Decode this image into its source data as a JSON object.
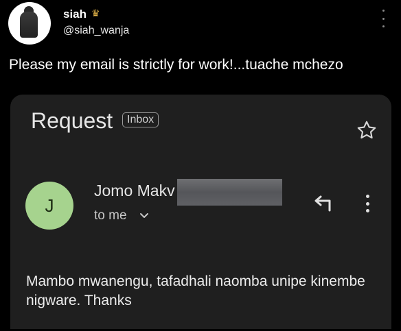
{
  "post": {
    "author_name": "siah",
    "author_badge": "crown-emoji-icon",
    "author_handle": "@siah_wanja",
    "text": "Please my email is strictly for work!...tuache mchezo",
    "more_icon": "vertical-dots-icon"
  },
  "email": {
    "subject": "Request",
    "label": "Inbox",
    "star_icon": "star-outline-icon",
    "sender_initial": "J",
    "sender_name": "Jomo Makv",
    "recipient": "to me",
    "body": "Mambo mwanengu, tafadhali naomba unipe kinembe nigware. Thanks",
    "colors": {
      "card_background": "#1f1f1f",
      "avatar_background": "#a6d38e"
    }
  }
}
